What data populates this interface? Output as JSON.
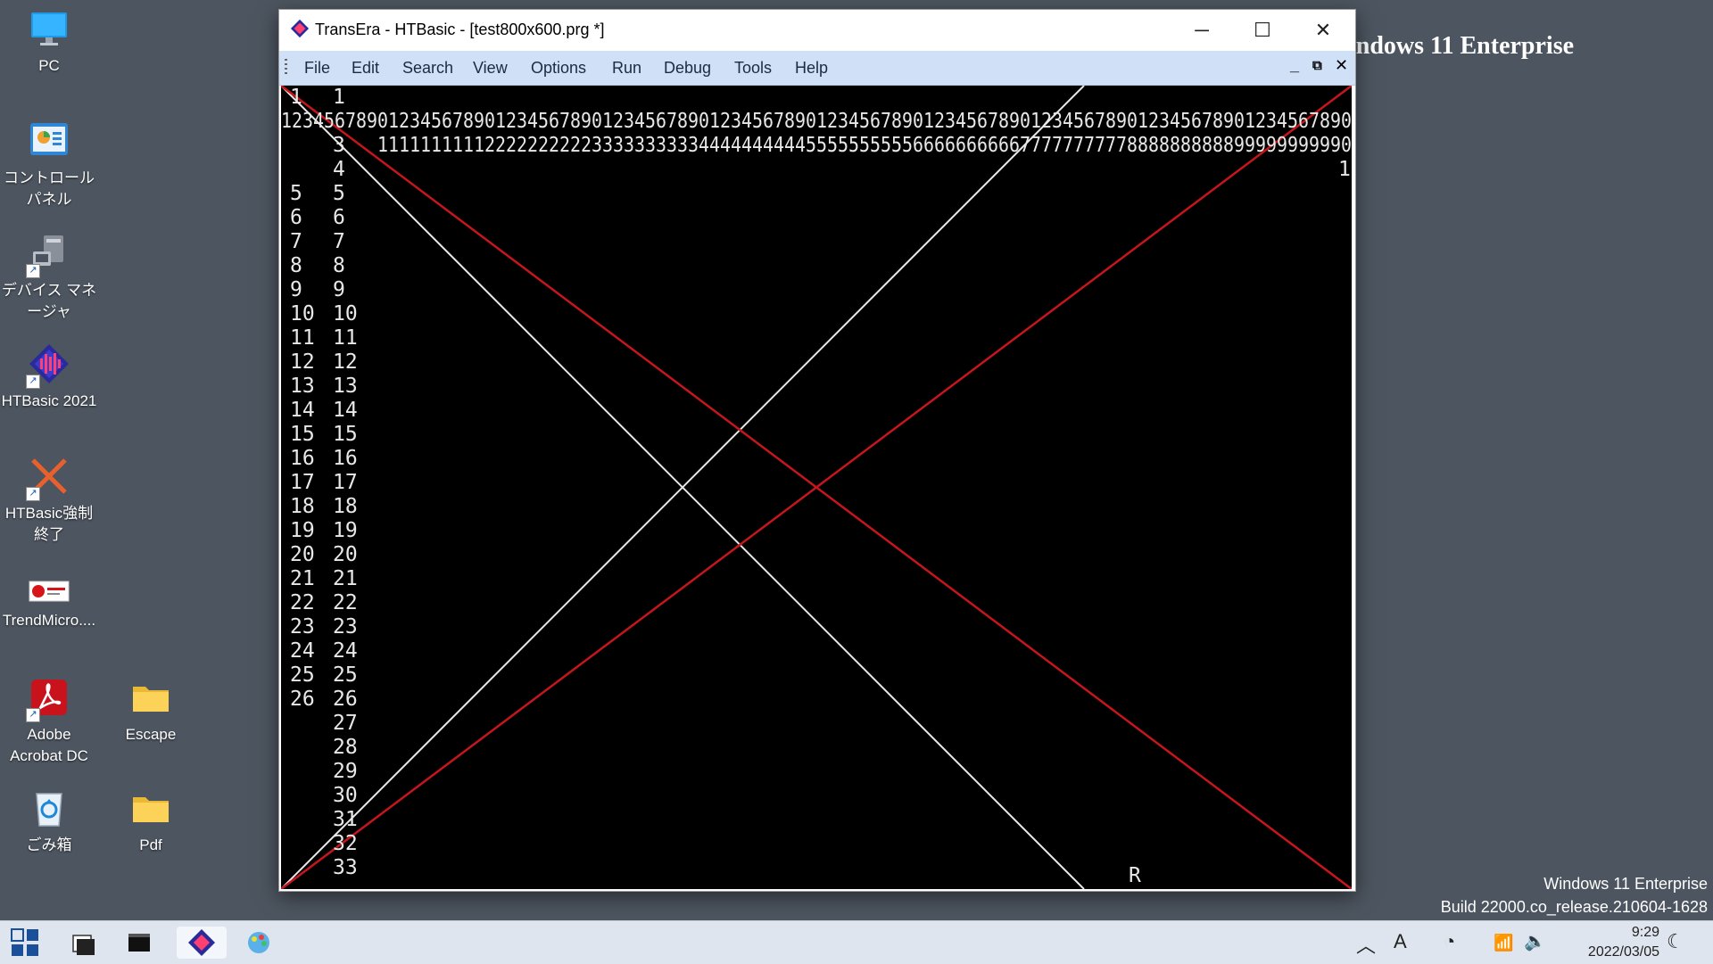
{
  "desktop": {
    "icons": [
      {
        "label": "PC"
      },
      {
        "label": "コントロール パネル"
      },
      {
        "label": "デバイス マネージャ"
      },
      {
        "label": "HTBasic 2021"
      },
      {
        "label": "HTBasic強制終了"
      },
      {
        "label": "TrendMicro...."
      },
      {
        "label": "Adobe Acrobat DC"
      },
      {
        "label": "Escape"
      },
      {
        "label": "ごみ箱"
      },
      {
        "label": "Pdf"
      }
    ],
    "background_title": "indows 11 Enterprise",
    "watermark": {
      "line1": "Windows 11 Enterprise",
      "line2": "Build 22000.co_release.210604-1628"
    }
  },
  "window": {
    "title": "TransEra - HTBasic - [test800x600.prg *]",
    "menus": [
      "File",
      "Edit",
      "Search",
      "View",
      "Options",
      "Run",
      "Debug",
      "Tools",
      "Help"
    ]
  },
  "screen": {
    "row1_a": "1",
    "row1_b": "1",
    "row2": "1234567890123456789012345678901234567890123456789012345678901234567890123456789012345678901234567890",
    "row3_a": "3",
    "row3_b": "1111111111222222222233333333334444444444555555555566666666667777777777888888888899999999990",
    "row4": "4",
    "row4_right": "1",
    "col_left": [
      "5",
      "6",
      "7",
      "8",
      "9",
      "10",
      "11",
      "12",
      "13",
      "14",
      "15",
      "16",
      "17",
      "18",
      "19",
      "20",
      "21",
      "22",
      "23",
      "24",
      "25",
      "26"
    ],
    "col_right": [
      "5",
      "6",
      "7",
      "8",
      "9",
      "10",
      "11",
      "12",
      "13",
      "14",
      "15",
      "16",
      "17",
      "18",
      "19",
      "20",
      "21",
      "22",
      "23",
      "24",
      "25",
      "26",
      "27",
      "28",
      "29",
      "30",
      "31",
      "32",
      "33"
    ],
    "cursor_char": "R",
    "line_colors": {
      "white": "#e8e8e8",
      "red": "#c4161c"
    }
  },
  "taskbar": {
    "time": "9:29",
    "date": "2022/03/05",
    "ime_char": "A"
  }
}
